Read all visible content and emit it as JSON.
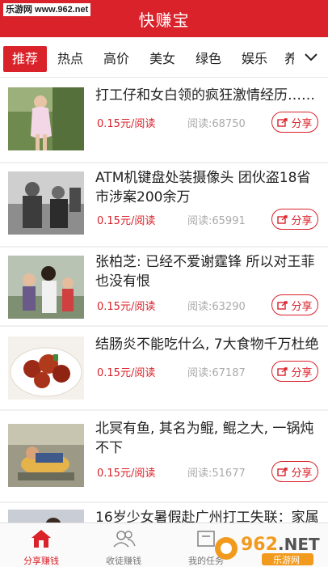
{
  "watermark_top": "乐游网 www.962.net",
  "header": {
    "title": "快赚宝"
  },
  "tabs": [
    {
      "label": "推荐",
      "active": true
    },
    {
      "label": "热点",
      "active": false
    },
    {
      "label": "高价",
      "active": false
    },
    {
      "label": "美女",
      "active": false
    },
    {
      "label": "绿色",
      "active": false
    },
    {
      "label": "娱乐",
      "active": false
    },
    {
      "label": "养",
      "active": false
    }
  ],
  "articles": [
    {
      "title": "打工仔和女白领的疯狂激情经历……",
      "price": "0.15元/阅读",
      "reads": "阅读:68750",
      "share": "分享"
    },
    {
      "title": "ATM机键盘处装摄像头 团伙盗18省市涉案200余万",
      "price": "0.15元/阅读",
      "reads": "阅读:65991",
      "share": "分享"
    },
    {
      "title": "张柏芝: 已经不爱谢霆锋 所以对王菲也没有恨",
      "price": "0.15元/阅读",
      "reads": "阅读:63290",
      "share": "分享"
    },
    {
      "title": "结肠炎不能吃什么, 7大食物千万杜绝",
      "price": "0.15元/阅读",
      "reads": "阅读:67187",
      "share": "分享"
    },
    {
      "title": "北冥有鱼, 其名为鲲, 鲲之大, 一锅炖不下",
      "price": "0.15元/阅读",
      "reads": "阅读:51677",
      "share": "分享"
    },
    {
      "title": "16岁少女暑假赴广州打工失联：家属",
      "price": "",
      "reads": "",
      "share": ""
    }
  ],
  "bottom_nav": [
    {
      "label": "分享赚钱",
      "icon": "home-icon",
      "active": true
    },
    {
      "label": "收徒赚钱",
      "icon": "people-icon",
      "active": false
    },
    {
      "label": "我的任务",
      "icon": "task-icon",
      "active": false
    }
  ],
  "watermark_bottom": {
    "number": "962",
    "suffix": ".NET",
    "text": "乐游网"
  },
  "colors": {
    "brand": "#d9222a",
    "muted": "#aaaaaa"
  }
}
